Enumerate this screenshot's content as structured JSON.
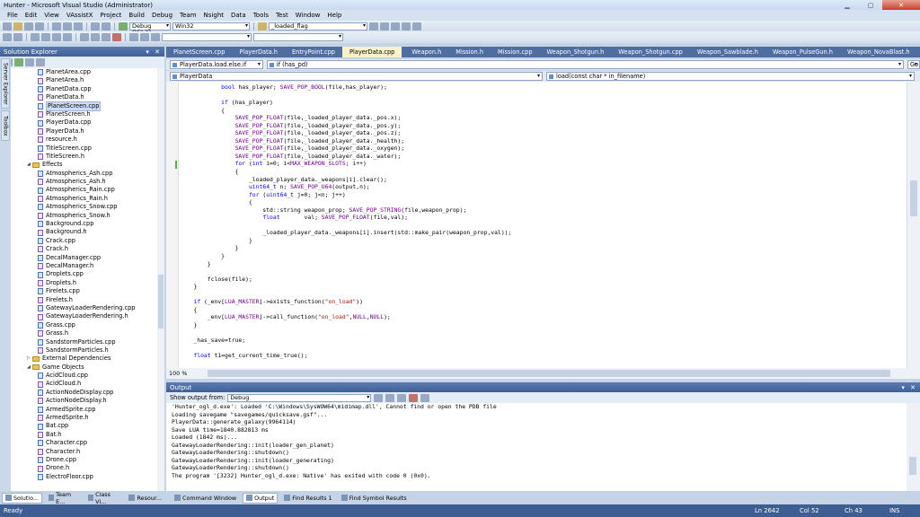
{
  "window": {
    "title": "Hunter - Microsoft Visual Studio (Administrator)"
  },
  "menu": [
    "File",
    "Edit",
    "View",
    "VAssistX",
    "Project",
    "Build",
    "Debug",
    "Team",
    "Nsight",
    "Data",
    "Tools",
    "Test",
    "Window",
    "Help"
  ],
  "toolbar": {
    "config": "Debug OGL31",
    "platform": "Win32",
    "find_value": "_loaded_flag"
  },
  "solution_explorer": {
    "title": "Solution Explorer",
    "side_tabs": [
      "Server Explorer",
      "Toolbox"
    ],
    "items": [
      {
        "label": "PlanetArea.cpp",
        "type": "cpp",
        "indent": 2
      },
      {
        "label": "PlanetArea.h",
        "type": "h",
        "indent": 2
      },
      {
        "label": "PlanetData.cpp",
        "type": "cpp",
        "indent": 2
      },
      {
        "label": "PlanetData.h",
        "type": "h",
        "indent": 2
      },
      {
        "label": "PlanetScreen.cpp",
        "type": "cpp",
        "indent": 2,
        "selected": true
      },
      {
        "label": "PlanetScreen.h",
        "type": "h",
        "indent": 2
      },
      {
        "label": "PlayerData.cpp",
        "type": "cpp",
        "indent": 2
      },
      {
        "label": "PlayerData.h",
        "type": "h",
        "indent": 2
      },
      {
        "label": "resource.h",
        "type": "h",
        "indent": 2
      },
      {
        "label": "TitleScreen.cpp",
        "type": "cpp",
        "indent": 2
      },
      {
        "label": "TitleScreen.h",
        "type": "h",
        "indent": 2
      },
      {
        "label": "Effects",
        "type": "folder",
        "indent": 1,
        "expanded": true
      },
      {
        "label": "Atmospherics_Ash.cpp",
        "type": "cpp",
        "indent": 2
      },
      {
        "label": "Atmospherics_Ash.h",
        "type": "h",
        "indent": 2
      },
      {
        "label": "Atmospherics_Rain.cpp",
        "type": "cpp",
        "indent": 2
      },
      {
        "label": "Atmospherics_Rain.h",
        "type": "h",
        "indent": 2
      },
      {
        "label": "Atmospherics_Snow.cpp",
        "type": "cpp",
        "indent": 2
      },
      {
        "label": "Atmospherics_Snow.h",
        "type": "h",
        "indent": 2
      },
      {
        "label": "Background.cpp",
        "type": "cpp",
        "indent": 2
      },
      {
        "label": "Background.h",
        "type": "h",
        "indent": 2
      },
      {
        "label": "Crack.cpp",
        "type": "cpp",
        "indent": 2
      },
      {
        "label": "Crack.h",
        "type": "h",
        "indent": 2
      },
      {
        "label": "DecalManager.cpp",
        "type": "cpp",
        "indent": 2
      },
      {
        "label": "DecalManager.h",
        "type": "h",
        "indent": 2
      },
      {
        "label": "Droplets.cpp",
        "type": "cpp",
        "indent": 2
      },
      {
        "label": "Droplets.h",
        "type": "h",
        "indent": 2
      },
      {
        "label": "Firelets.cpp",
        "type": "cpp",
        "indent": 2
      },
      {
        "label": "Firelets.h",
        "type": "h",
        "indent": 2
      },
      {
        "label": "GatewayLoaderRendering.cpp",
        "type": "cpp",
        "indent": 2
      },
      {
        "label": "GatewayLoaderRendering.h",
        "type": "h",
        "indent": 2
      },
      {
        "label": "Grass.cpp",
        "type": "cpp",
        "indent": 2
      },
      {
        "label": "Grass.h",
        "type": "h",
        "indent": 2
      },
      {
        "label": "SandstormParticles.cpp",
        "type": "cpp",
        "indent": 2
      },
      {
        "label": "SandstormParticles.h",
        "type": "h",
        "indent": 2
      },
      {
        "label": "External Dependencies",
        "type": "folder",
        "indent": 1,
        "expanded": false
      },
      {
        "label": "Game Objects",
        "type": "folder",
        "indent": 1,
        "expanded": true
      },
      {
        "label": "AcidCloud.cpp",
        "type": "cpp",
        "indent": 2
      },
      {
        "label": "AcidCloud.h",
        "type": "h",
        "indent": 2
      },
      {
        "label": "ActionNodeDisplay.cpp",
        "type": "cpp",
        "indent": 2
      },
      {
        "label": "ActionNodeDisplay.h",
        "type": "h",
        "indent": 2
      },
      {
        "label": "ArmedSprite.cpp",
        "type": "cpp",
        "indent": 2
      },
      {
        "label": "ArmedSprite.h",
        "type": "h",
        "indent": 2
      },
      {
        "label": "Bat.cpp",
        "type": "cpp",
        "indent": 2
      },
      {
        "label": "Bat.h",
        "type": "h",
        "indent": 2
      },
      {
        "label": "Character.cpp",
        "type": "cpp",
        "indent": 2
      },
      {
        "label": "Character.h",
        "type": "h",
        "indent": 2
      },
      {
        "label": "Drone.cpp",
        "type": "cpp",
        "indent": 2
      },
      {
        "label": "Drone.h",
        "type": "h",
        "indent": 2
      },
      {
        "label": "ElectroFloor.cpp",
        "type": "cpp",
        "indent": 2
      }
    ],
    "bottom_tabs": [
      "Solutio...",
      "Team E...",
      "Class Vi...",
      "Resour..."
    ]
  },
  "doc_tabs": [
    {
      "label": "PlanetScreen.cpp"
    },
    {
      "label": "PlayerData.h"
    },
    {
      "label": "EntryPoint.cpp"
    },
    {
      "label": "PlayerData.cpp",
      "active": true
    },
    {
      "label": "Weapon.h"
    },
    {
      "label": "Mission.h"
    },
    {
      "label": "Mission.cpp"
    },
    {
      "label": "Weapon_Shotgun.h"
    },
    {
      "label": "Weapon_Shotgun.cpp"
    },
    {
      "label": "Weapon_Sawblade.h"
    },
    {
      "label": "Weapon_PulseGun.h"
    },
    {
      "label": "Weapon_NovaBlast.h"
    }
  ],
  "nav": {
    "scope": "PlayerData.load.else.if",
    "context": "if (has_pd)",
    "class": "PlayerData",
    "member": "load(const char * in_filename)",
    "go_label": "Go"
  },
  "code_lines": [
    {
      "text": "            bool has_player; SAVE_POP_BOOL(file,has_player);"
    },
    {
      "text": ""
    },
    {
      "text": "            if (has_player)"
    },
    {
      "text": "            {"
    },
    {
      "text": "                SAVE_POP_FLOAT(file,_loaded_player_data._pos.x);"
    },
    {
      "text": "                SAVE_POP_FLOAT(file,_loaded_player_data._pos.y);"
    },
    {
      "text": "                SAVE_POP_FLOAT(file,_loaded_player_data._pos.z);"
    },
    {
      "text": "                SAVE_POP_FLOAT(file,_loaded_player_data._health);"
    },
    {
      "text": "                SAVE_POP_FLOAT(file,_loaded_player_data._oxygen);"
    },
    {
      "text": "                SAVE_POP_FLOAT(file,_loaded_player_data._water);"
    },
    {
      "text": "                for (int i=0; i<MAX_WEAPON_SLOTS; i++)",
      "changed": true
    },
    {
      "text": "                {"
    },
    {
      "text": "                    _loaded_player_data._weapons[i].clear();"
    },
    {
      "text": "                    uint64_t n; SAVE_POP_U64(output,n);"
    },
    {
      "text": "                    for (uint64_t j=0; j<n; j++)"
    },
    {
      "text": "                    {"
    },
    {
      "text": "                        std::string weapon_prop; SAVE_POP_STRING(file,weapon_prop);"
    },
    {
      "text": "                        float       val; SAVE_POP_FLOAT(file,val);"
    },
    {
      "text": ""
    },
    {
      "text": "                        _loaded_player_data._weapons[i].insert(std::make_pair(weapon_prop,val));"
    },
    {
      "text": "                    }"
    },
    {
      "text": "                }"
    },
    {
      "text": "            }"
    },
    {
      "text": "        }"
    },
    {
      "text": ""
    },
    {
      "text": "        fclose(file);"
    },
    {
      "text": "    }"
    },
    {
      "text": ""
    },
    {
      "text": "    if (_env[LUA_MASTER]->exists_function(\"on_load\"))"
    },
    {
      "text": "    {"
    },
    {
      "text": "        _env[LUA_MASTER]->call_function(\"on_load\",NULL,NULL);"
    },
    {
      "text": "    }"
    },
    {
      "text": ""
    },
    {
      "text": "    _has_save=true;"
    },
    {
      "text": ""
    },
    {
      "text": "    float t1=get_current_time_true();"
    },
    {
      "text": ""
    }
  ],
  "zoom": "100 %",
  "output": {
    "title": "Output",
    "show_from_label": "Show output from:",
    "source": "Debug",
    "lines": [
      "'Hunter_ogl_d.exe': Loaded 'C:\\Windows\\SysWOW64\\midimap.dll', Cannot find or open the PDB file",
      "Loading savegame \"savegames/quicksave.gsf\"...",
      "PlayerData::generate_galaxy(9964114)",
      "Save LUA time=1840.882813 ms",
      "Loaded (1842 ms)...",
      "GatewayLoaderRendering::init(loader_gen_planet)",
      "GatewayLoaderRendering::shutdown()",
      "GatewayLoaderRendering::init(loader_generating)",
      "GatewayLoaderRendering::shutdown()",
      "The program '[3232] Hunter_ogl_d.exe: Native' has exited with code 0 (0x0)."
    ],
    "bottom_tabs": [
      "Command Window",
      "Output",
      "Find Results 1",
      "Find Symbol Results"
    ]
  },
  "status": {
    "ready": "Ready",
    "ln": "Ln 2642",
    "col": "Col 52",
    "ch": "Ch 43",
    "ins": "INS"
  }
}
